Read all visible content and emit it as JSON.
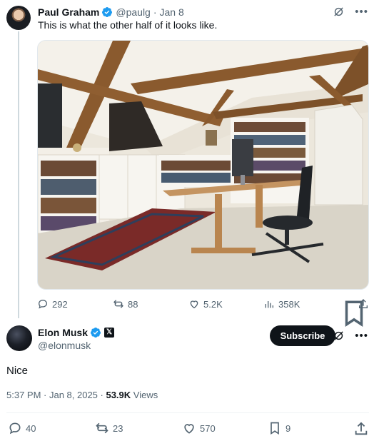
{
  "reply_parent": {
    "author_name": "Paul Graham",
    "handle": "@paulg",
    "separator": "·",
    "date": "Jan 8",
    "text": "This is what the other half of it looks like.",
    "stats": {
      "replies": "292",
      "reposts": "88",
      "likes": "5.2K",
      "views": "358K"
    }
  },
  "main_tweet": {
    "author_name": "Elon Musk",
    "handle": "@elonmusk",
    "subscribe_label": "Subscribe",
    "text": "Nice",
    "time": "5:37 PM · Jan 8, 2025 · ",
    "views_count": "53.9K",
    "views_label": "Views",
    "stats": {
      "replies": "40",
      "reposts": "23",
      "likes": "570",
      "bookmarks": "9"
    }
  },
  "colors": {
    "verified_blue": "#1d9bf0",
    "text_primary": "#0f1419",
    "text_secondary": "#536471"
  },
  "icons": [
    "grok-icon",
    "more-icon",
    "reply-icon",
    "repost-icon",
    "like-icon",
    "views-icon",
    "bookmark-icon",
    "share-icon",
    "verified-icon",
    "x-affiliate-badge"
  ]
}
